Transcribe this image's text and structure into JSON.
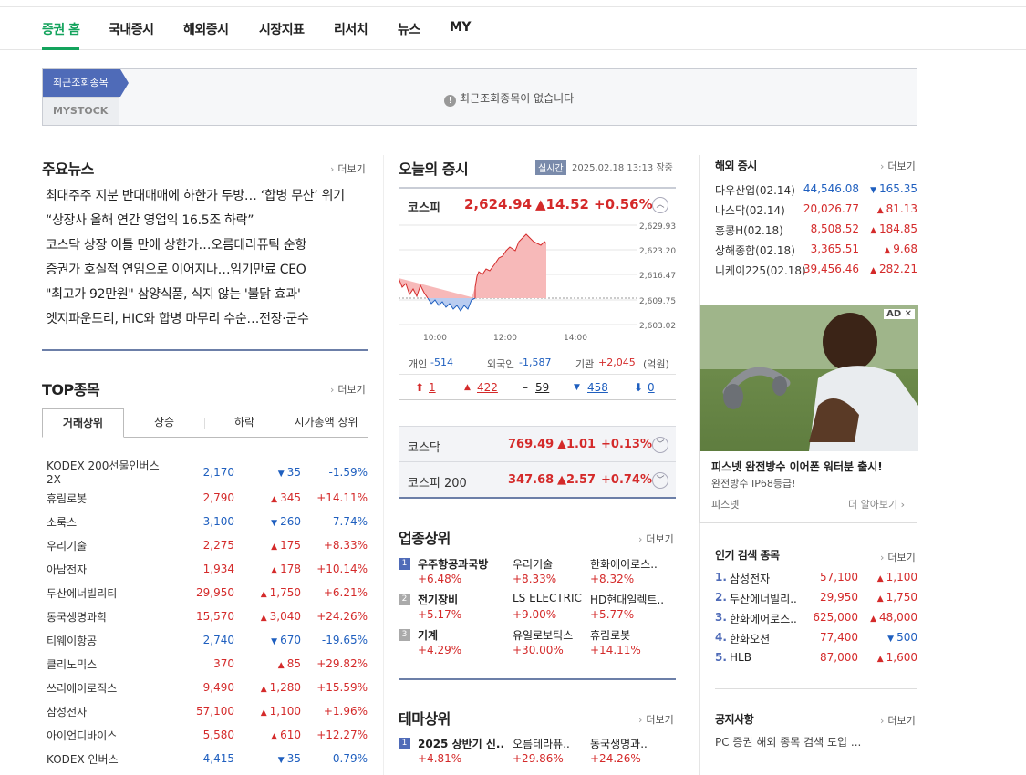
{
  "nav": {
    "items": [
      "증권 홈",
      "국내증시",
      "해외증시",
      "시장지표",
      "리서치",
      "뉴스",
      "MY"
    ],
    "active": 0
  },
  "recent": {
    "tab1": "최근조회종목",
    "tab2": "MYSTOCK",
    "empty_msg": "최근조회종목이 없습니다",
    "info_icon": "!"
  },
  "news": {
    "title": "주요뉴스",
    "more": "더보기",
    "items": [
      "최대주주 지분 반대매매에 하한가 두방… ‘합병 무산’ 위기",
      "“상장사 올해 연간 영업익 16.5조 하락”",
      "코스닥 상장 이틀 만에 상한가…오름테라퓨틱 순항",
      "증권가 호실적 연임으로 이어지나…임기만료 CEO",
      "\"최고가 92만원\" 삼양식품, 식지 않는 '불닭 효과'",
      "엣지파운드리, HIC와 합병 마무리 수순…전장·군수"
    ]
  },
  "top": {
    "title": "TOP종목",
    "more": "더보기",
    "tabs": [
      "거래상위",
      "상승",
      "하락",
      "시가총액 상위"
    ],
    "rows": [
      {
        "name": "KODEX 200선물인버스2X",
        "price": "2,170",
        "dir": "down",
        "chg": "35",
        "rate": "-1.59%"
      },
      {
        "name": "휴림로봇",
        "price": "2,790",
        "dir": "up",
        "chg": "345",
        "rate": "+14.11%"
      },
      {
        "name": "소룩스",
        "price": "3,100",
        "dir": "down",
        "chg": "260",
        "rate": "-7.74%"
      },
      {
        "name": "우리기술",
        "price": "2,275",
        "dir": "up",
        "chg": "175",
        "rate": "+8.33%"
      },
      {
        "name": "아남전자",
        "price": "1,934",
        "dir": "up",
        "chg": "178",
        "rate": "+10.14%"
      },
      {
        "name": "두산에너빌리티",
        "price": "29,950",
        "dir": "up",
        "chg": "1,750",
        "rate": "+6.21%"
      },
      {
        "name": "동국생명과학",
        "price": "15,570",
        "dir": "up",
        "chg": "3,040",
        "rate": "+24.26%"
      },
      {
        "name": "티웨이항공",
        "price": "2,740",
        "dir": "down",
        "chg": "670",
        "rate": "-19.65%"
      },
      {
        "name": "클리노믹스",
        "price": "370",
        "dir": "up",
        "chg": "85",
        "rate": "+29.82%"
      },
      {
        "name": "쓰리에이로직스",
        "price": "9,490",
        "dir": "up",
        "chg": "1,280",
        "rate": "+15.59%"
      },
      {
        "name": "삼성전자",
        "price": "57,100",
        "dir": "up",
        "chg": "1,100",
        "rate": "+1.96%"
      },
      {
        "name": "아이언디바이스",
        "price": "5,580",
        "dir": "up",
        "chg": "610",
        "rate": "+12.27%"
      },
      {
        "name": "KODEX 인버스",
        "price": "4,415",
        "dir": "down",
        "chg": "35",
        "rate": "-0.79%"
      }
    ]
  },
  "market": {
    "title": "오늘의 증시",
    "badge": "실시간",
    "datetime": "2025.02.18 13:13",
    "status": "장중",
    "kospi": {
      "name": "코스피",
      "value": "2,624.94",
      "change": "▲14.52",
      "rate": "+0.56%"
    },
    "chart_yticks": [
      "2,629.93",
      "2,623.20",
      "2,616.47",
      "2,609.75",
      "2,603.02"
    ],
    "chart_xticks": [
      "10:00",
      "12:00",
      "14:00"
    ],
    "investors": {
      "personal_label": "개인",
      "personal": "-514",
      "foreign_label": "외국인",
      "foreign": "-1,587",
      "inst_label": "기관",
      "inst": "+2,045",
      "unit": "(억원)"
    },
    "updown": {
      "upper": "1",
      "up": "422",
      "flat": "59",
      "down": "458",
      "lower": "0"
    },
    "kosdaq": {
      "name": "코스닥",
      "value": "769.49",
      "change": "▲1.01",
      "rate": "+0.13%"
    },
    "kospi200": {
      "name": "코스피 200",
      "value": "347.68",
      "change": "▲2.57",
      "rate": "+0.74%"
    }
  },
  "sectors": {
    "title": "업종상위",
    "more": "더보기",
    "rows": [
      {
        "rank": "1",
        "name": "우주항공과국방",
        "rate": "+6.48%",
        "s1": "우리기술",
        "s1r": "+8.33%",
        "s2": "한화에어로스..",
        "s2r": "+8.32%"
      },
      {
        "rank": "2",
        "name": "전기장비",
        "rate": "+5.17%",
        "s1": "LS ELECTRIC",
        "s1r": "+9.00%",
        "s2": "HD현대일렉트..",
        "s2r": "+5.77%"
      },
      {
        "rank": "3",
        "name": "기계",
        "rate": "+4.29%",
        "s1": "유일로보틱스",
        "s1r": "+30.00%",
        "s2": "휴림로봇",
        "s2r": "+14.11%"
      }
    ]
  },
  "themes": {
    "title": "테마상위",
    "more": "더보기",
    "rows": [
      {
        "rank": "1",
        "name": "2025 상반기 신..",
        "rate": "+4.81%",
        "s1": "오름테라퓨..",
        "s1r": "+29.86%",
        "s2": "동국생명과..",
        "s2r": "+24.26%"
      }
    ]
  },
  "overseas": {
    "title": "해외 증시",
    "more": "더보기",
    "rows": [
      {
        "name": "다우산업(02.14)",
        "price": "44,546.08",
        "dir": "down",
        "chg": "165.35"
      },
      {
        "name": "나스닥(02.14)",
        "price": "20,026.77",
        "dir": "up",
        "chg": "81.13"
      },
      {
        "name": "홍콩H(02.18)",
        "price": "8,508.52",
        "dir": "up",
        "chg": "184.85"
      },
      {
        "name": "상해종합(02.18)",
        "price": "3,365.51",
        "dir": "up",
        "chg": "9.68"
      },
      {
        "name": "니케이225(02.18)",
        "price": "39,456.46",
        "dir": "up",
        "chg": "282.21"
      }
    ]
  },
  "ad": {
    "tag": "AD",
    "close": "✕",
    "headline": "피스넷 완전방수 이어폰 워터분 출시!",
    "sub": "완전방수 IP68등급!",
    "brand": "피스넷",
    "cta": "더 알아보기"
  },
  "popular": {
    "title": "인기 검색 종목",
    "more": "더보기",
    "rows": [
      {
        "rank": "1.",
        "name": "삼성전자",
        "price": "57,100",
        "dir": "up",
        "chg": "1,100"
      },
      {
        "rank": "2.",
        "name": "두산에너빌리..",
        "price": "29,950",
        "dir": "up",
        "chg": "1,750"
      },
      {
        "rank": "3.",
        "name": "한화에어로스..",
        "price": "625,000",
        "dir": "up",
        "chg": "48,000"
      },
      {
        "rank": "4.",
        "name": "한화오션",
        "price": "77,400",
        "dir": "down",
        "chg": "500"
      },
      {
        "rank": "5.",
        "name": "HLB",
        "price": "87,000",
        "dir": "up",
        "chg": "1,600"
      }
    ]
  },
  "notice": {
    "title": "공지사항",
    "more": "더보기",
    "item": "PC 증권 해외 종목 검색 도입 ..."
  },
  "colors": {
    "accent": "#13a35c",
    "up": "#d42a2a",
    "down": "#1f5fbf",
    "tab": "#4f6bb8"
  }
}
